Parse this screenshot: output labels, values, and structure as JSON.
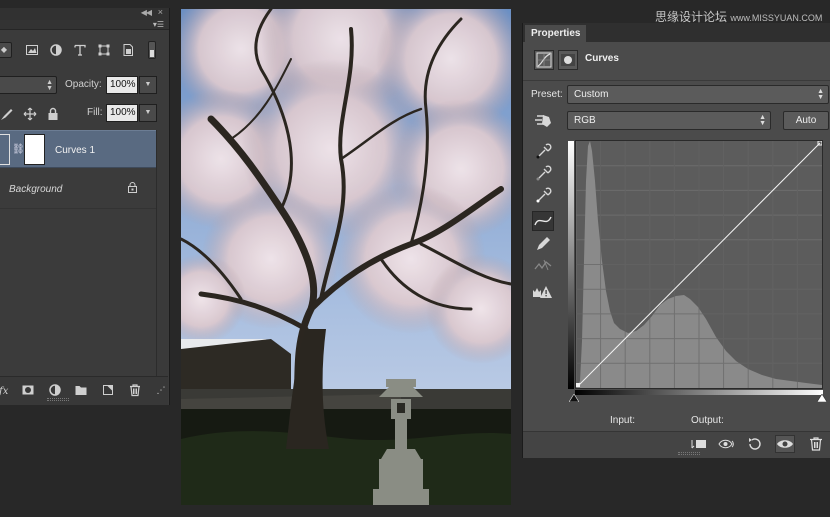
{
  "watermark": {
    "text": "思缘设计论坛",
    "url": "www.MISSYUAN.COM"
  },
  "layers": {
    "opacity_label": "Opacity:",
    "opacity_value": "100%",
    "fill_label": "Fill:",
    "fill_value": "100%",
    "items": [
      {
        "name": "Curves 1",
        "selected": true
      },
      {
        "name": "Background",
        "locked": true
      }
    ]
  },
  "properties": {
    "tab_label": "Properties",
    "adjustment_title": "Curves",
    "preset_label": "Preset:",
    "preset_value": "Custom",
    "channel_value": "RGB",
    "auto_label": "Auto",
    "input_label": "Input:",
    "output_label": "Output:"
  },
  "colors": {
    "panel_bg": "#3b3b3b",
    "properties_bg": "#4b4b4b",
    "selected_layer": "#596a81",
    "histogram": "#8a8a8a"
  },
  "icons": {
    "layers_filter": [
      "image-filter-icon",
      "adjustment-filter-icon",
      "type-filter-icon",
      "shape-filter-icon",
      "smart-object-filter-icon"
    ],
    "lock_row": [
      "lock-pixels-icon",
      "lock-position-icon",
      "lock-all-icon"
    ],
    "layers_footer": [
      "fx-icon",
      "mask-icon",
      "new-adjustment-icon",
      "group-icon",
      "new-layer-icon",
      "trash-icon"
    ],
    "curve_tools": [
      "target-adjust-icon",
      "black-eyedropper-icon",
      "gray-eyedropper-icon",
      "white-eyedropper-icon",
      "curve-point-icon",
      "pencil-icon",
      "smooth-icon",
      "clipping-warning-icon"
    ],
    "properties_footer": [
      "clip-to-layer-icon",
      "view-previous-icon",
      "reset-icon",
      "visibility-icon",
      "trash-icon"
    ]
  }
}
